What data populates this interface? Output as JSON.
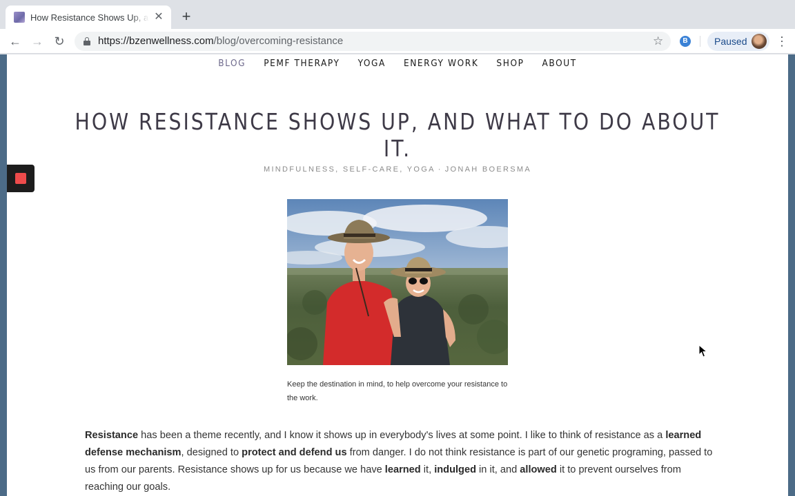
{
  "browser": {
    "tab": {
      "title": "How Resistance Shows Up, and What to Do About It.",
      "close_glyph": "✕"
    },
    "new_tab_glyph": "+",
    "nav": {
      "back_glyph": "←",
      "forward_glyph": "→",
      "reload_glyph": "↻"
    },
    "address": {
      "host": "https://bzenwellness.com",
      "path": "/blog/overcoming-resistance"
    },
    "bookmark_glyph": "☆",
    "extension_label": "B",
    "profile": {
      "label": "Paused"
    },
    "menu_glyph": "⋮"
  },
  "site": {
    "nav": [
      {
        "label": "BLOG",
        "active": true
      },
      {
        "label": "PEMF THERAPY",
        "active": false
      },
      {
        "label": "YOGA",
        "active": false
      },
      {
        "label": "ENERGY WORK",
        "active": false
      },
      {
        "label": "SHOP",
        "active": false
      },
      {
        "label": "ABOUT",
        "active": false
      }
    ]
  },
  "post": {
    "title": "HOW RESISTANCE SHOWS UP, AND WHAT TO DO ABOUT IT.",
    "categories": "MINDFULNESS, SELF-CARE, YOGA",
    "separator": "·",
    "author": "JONAH BOERSMA",
    "image_caption": "Keep the destination in mind, to help overcome your resistance to the work.",
    "paragraph": [
      {
        "text": "Resistance",
        "bold": true
      },
      {
        "text": " has been a theme recently, and I know it shows up in everybody's lives at some point. I like to think of resistance as a ",
        "bold": false
      },
      {
        "text": "learned defense mechanism",
        "bold": true
      },
      {
        "text": ", designed to ",
        "bold": false
      },
      {
        "text": "protect and defend us",
        "bold": true
      },
      {
        "text": " from danger. I do not think resistance is part of our genetic programing, passed to us from our parents. Resistance shows up for us because we have ",
        "bold": false
      },
      {
        "text": "learned",
        "bold": true
      },
      {
        "text": " it, ",
        "bold": false
      },
      {
        "text": "indulged",
        "bold": true
      },
      {
        "text": " in it, and ",
        "bold": false
      },
      {
        "text": "allowed",
        "bold": true
      },
      {
        "text": " it to prevent ourselves from reaching our goals.",
        "bold": false
      }
    ]
  },
  "colors": {
    "nav_active": "#6e6a8c",
    "title": "#3e3a47",
    "record": "#ee4b4b"
  }
}
